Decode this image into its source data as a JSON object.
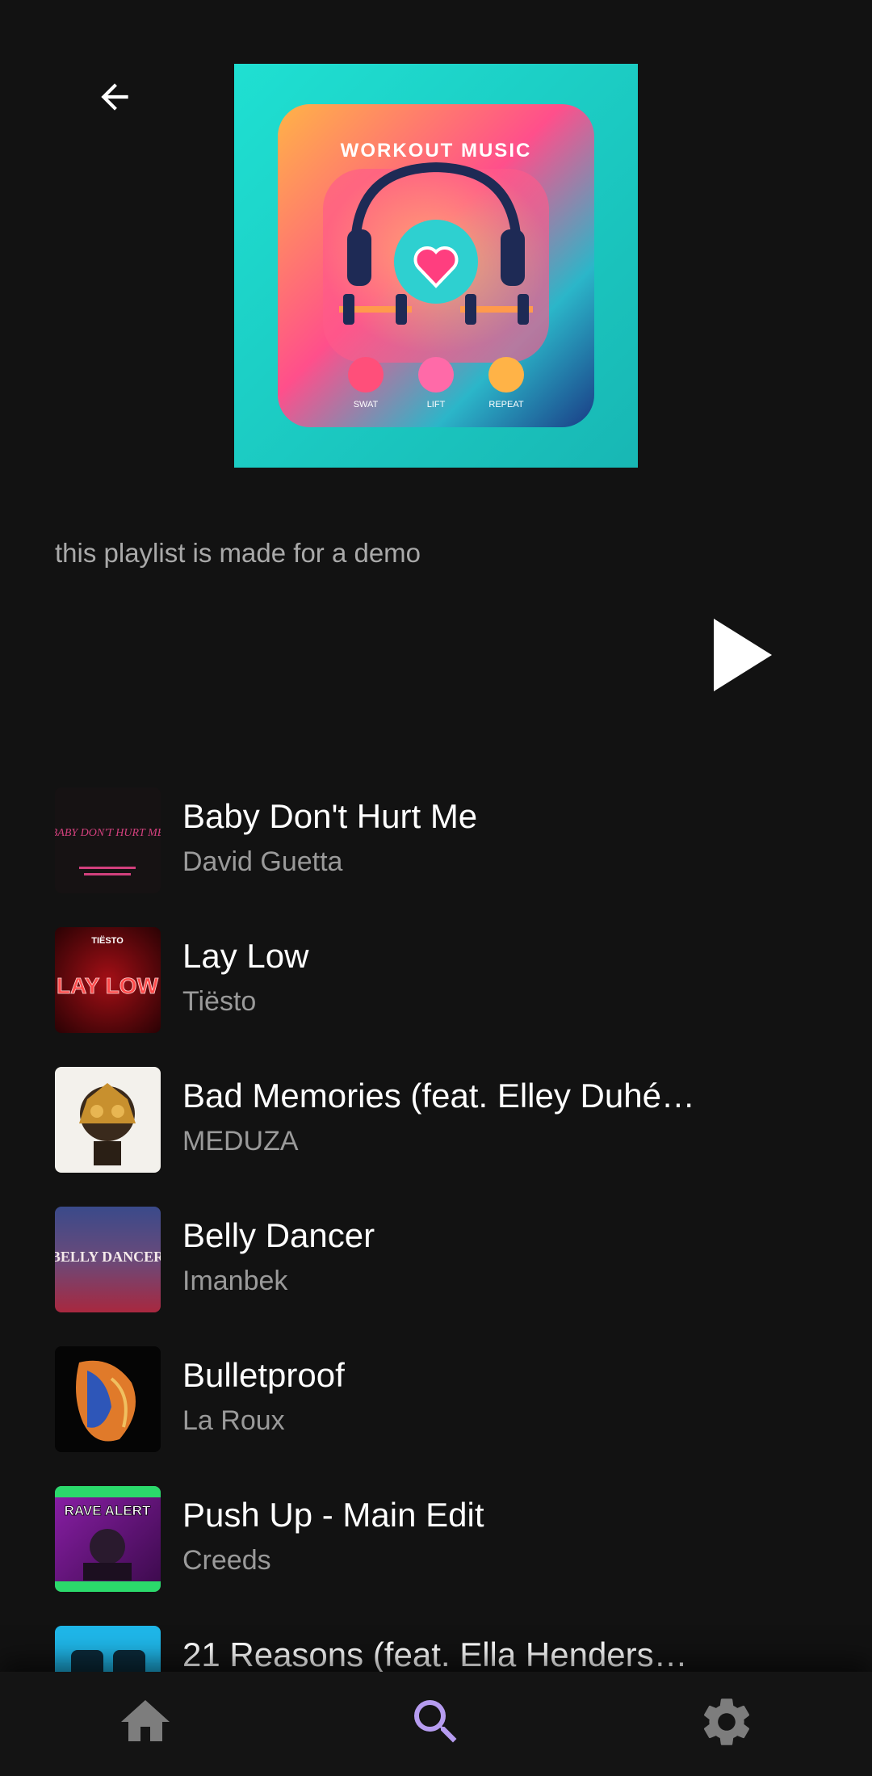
{
  "header": {
    "back_icon": "arrow-left-icon",
    "cover_title": "WORKOUT MUSIC",
    "cover_labels": [
      "SWAT",
      "LIFT",
      "REPEAT"
    ]
  },
  "playlist": {
    "description": "this playlist is made for a demo",
    "play_icon": "play-icon"
  },
  "tracks": [
    {
      "title": "Baby Don't Hurt Me",
      "artist": "David Guetta",
      "art_text": "BABY DON'T HURT ME"
    },
    {
      "title": "Lay Low",
      "artist": "Tiësto",
      "art_text": "LAY LOW"
    },
    {
      "title": "Bad Memories (feat. Elley Duhé…",
      "artist": "MEDUZA",
      "art_text": ""
    },
    {
      "title": "Belly Dancer",
      "artist": "Imanbek",
      "art_text": "BELLY DANCER"
    },
    {
      "title": "Bulletproof",
      "artist": "La Roux",
      "art_text": ""
    },
    {
      "title": "Push Up - Main Edit",
      "artist": "Creeds",
      "art_text": "RAVE ALERT"
    },
    {
      "title": "21 Reasons (feat. Ella Henders…",
      "artist": "",
      "art_text": ""
    }
  ],
  "nav": {
    "items": [
      {
        "icon": "home-icon",
        "active": false
      },
      {
        "icon": "search-icon",
        "active": true
      },
      {
        "icon": "gear-icon",
        "active": false
      }
    ],
    "colors": {
      "active": "#b69cf0",
      "inactive": "#7d7d7d"
    }
  },
  "colors": {
    "background": "#121212",
    "text_primary": "#ffffff",
    "text_secondary": "#9a9a9a"
  }
}
